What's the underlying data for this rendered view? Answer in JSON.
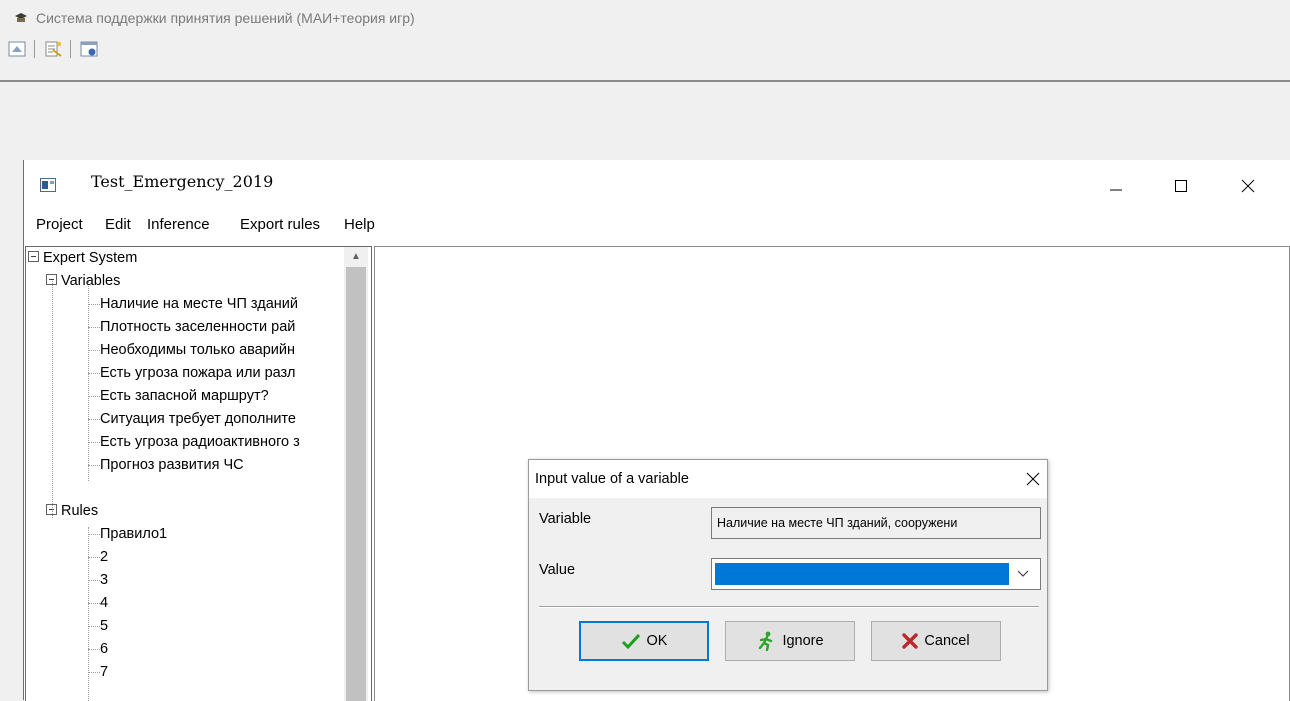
{
  "app": {
    "title": "Система поддержки принятия решений (МАИ+теория игр)"
  },
  "toolbar": {
    "buttons": [
      "home-window-icon",
      "wizard-icon",
      "window-settings-icon"
    ]
  },
  "child_window": {
    "title": "Test_Emergency_2019"
  },
  "menu": [
    "Project",
    "Edit",
    "Inference",
    "Export rules",
    "Help"
  ],
  "tree": {
    "root": "Expert System",
    "variables_label": "Variables",
    "variables": [
      "Наличие на месте ЧП зданий",
      "Плотность заселенности рай",
      "Необходимы только аварийн",
      "Есть угроза пожара или разл",
      "Есть запасной маршрут?",
      "Ситуация требует дополните",
      "Есть угроза радиоактивного з",
      "Прогноз развития ЧС"
    ],
    "rules_label": "Rules",
    "rules": [
      "Правило1",
      "2",
      "3",
      "4",
      "5",
      "6",
      "7"
    ]
  },
  "dialog": {
    "title": "Input value of a variable",
    "variable_label": "Variable",
    "variable_value": "Наличие на месте ЧП зданий, сооружени",
    "value_label": "Value",
    "value_selected": "",
    "buttons": {
      "ok": "OK",
      "ignore": "Ignore",
      "cancel": "Cancel"
    }
  },
  "colors": {
    "selection": "#0078d7",
    "ok_check": "#1aa01a",
    "cancel_x": "#c0272d",
    "ignore_figure": "#2aa52a"
  }
}
